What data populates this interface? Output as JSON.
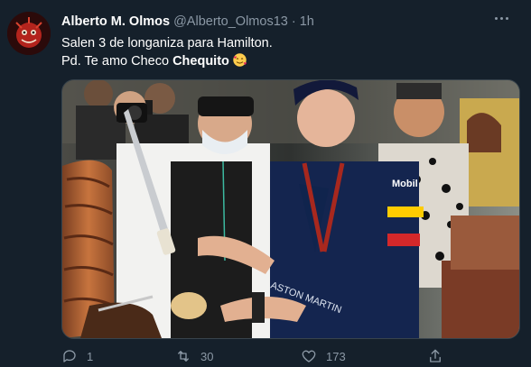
{
  "tweet": {
    "author_name": "Alberto M. Olmos",
    "handle": "@Alberto_Olmos13",
    "separator": "·",
    "time": "1h",
    "text_line1": "Salen 3 de longaniza para Hamilton.",
    "text_line2_prefix": "Pd. Te amo Checo ",
    "text_line2_bold": "Chequito",
    "emoji_name": "smiling-face-with-hearts",
    "image_description_icon": "photo"
  },
  "actions": {
    "reply_count": "1",
    "retweet_count": "30",
    "like_count": "173"
  },
  "colors": {
    "background": "#15202b",
    "secondary_text": "#8b98a5",
    "border": "#38444d"
  }
}
